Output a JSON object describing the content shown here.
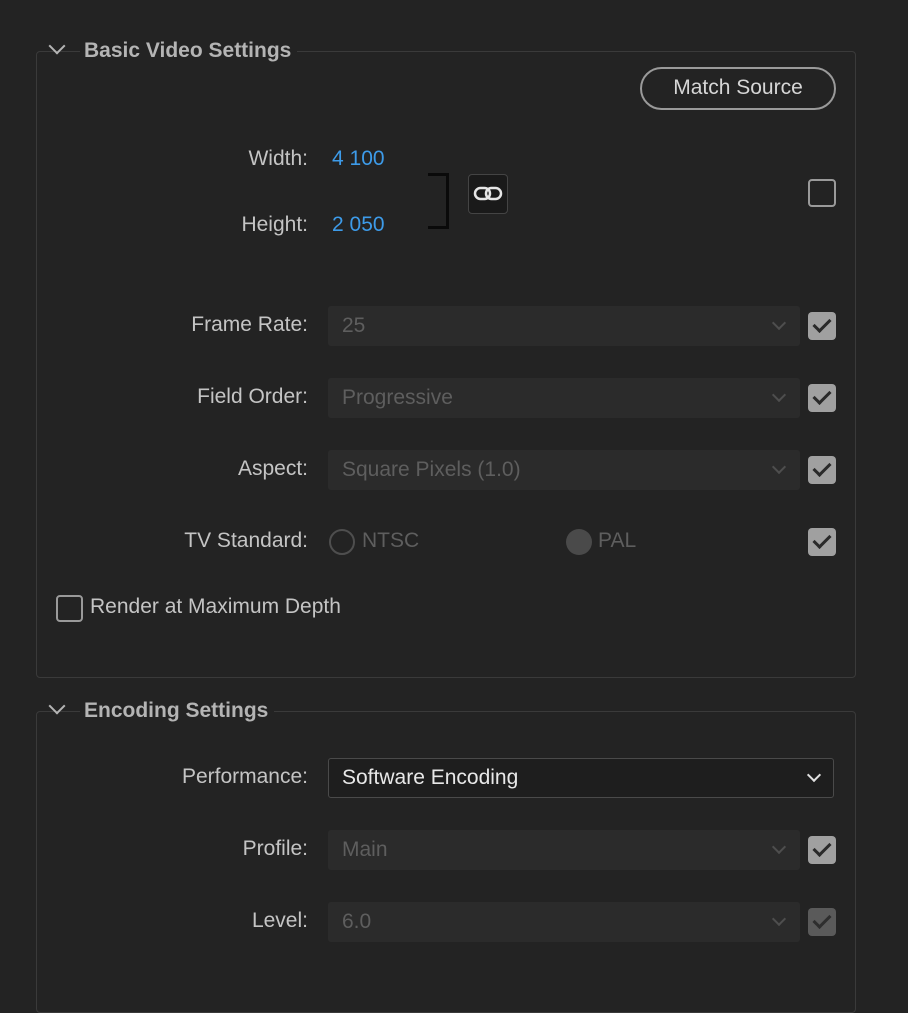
{
  "basic": {
    "title": "Basic Video Settings",
    "match_source": "Match Source",
    "width_label": "Width:",
    "width_value": "4 100",
    "height_label": "Height:",
    "height_value": "2 050",
    "link_icon": "link-icon",
    "frame_rate_label": "Frame Rate:",
    "frame_rate_value": "25",
    "field_order_label": "Field Order:",
    "field_order_value": "Progressive",
    "aspect_label": "Aspect:",
    "aspect_value": "Square Pixels (1.0)",
    "tv_standard_label": "TV Standard:",
    "ntsc_label": "NTSC",
    "pal_label": "PAL",
    "render_max_depth_label": "Render at Maximum Depth"
  },
  "encoding": {
    "title": "Encoding Settings",
    "performance_label": "Performance:",
    "performance_value": "Software Encoding",
    "profile_label": "Profile:",
    "profile_value": "Main",
    "level_label": "Level:",
    "level_value": "6.0"
  }
}
